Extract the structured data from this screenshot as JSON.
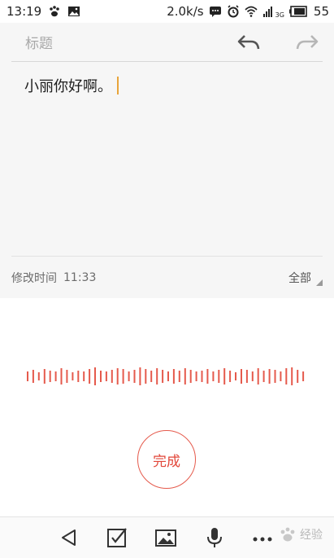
{
  "status_bar": {
    "time": "13:19",
    "left_icons": [
      "paw-icon",
      "image-icon"
    ],
    "network_speed": "2.0k/s",
    "right_icons": [
      "message-icon",
      "alarm-icon",
      "wifi-icon",
      "signal-icon",
      "battery-icon"
    ],
    "network_type": "3G",
    "battery_level": "55"
  },
  "editor": {
    "title_placeholder": "标题",
    "body_text": "小丽你好啊。",
    "modified_label": "修改时间",
    "modified_time": "11:33",
    "scope_label": "全部"
  },
  "voice": {
    "done_label": "完成",
    "accent_color": "#e55a4c"
  },
  "toolbar": {
    "items": [
      "back-icon",
      "checkbox-icon",
      "image-icon",
      "microphone-icon",
      "more-icon"
    ]
  },
  "watermark": {
    "text": "经验"
  }
}
